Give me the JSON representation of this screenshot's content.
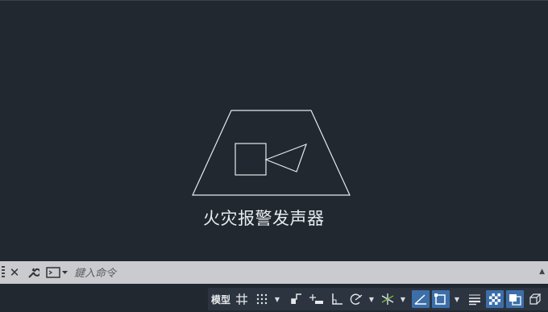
{
  "drawing": {
    "caption": "火灾报警发声器"
  },
  "command_line": {
    "placeholder": "鍵入命令"
  },
  "status_bar": {
    "model_tab": "模型",
    "accent_color": "#3c6fa9",
    "background": "#212830",
    "icons": [
      "grid-icon",
      "snap-grid-icon",
      "infer-constraints-icon",
      "dynamic-input-icon",
      "ortho-icon",
      "polar-tracking-icon",
      "isometric-icon",
      "object-snap-tracking-icon",
      "object-snap-icon",
      "lineweight-icon",
      "transparency-icon",
      "selection-cycling-icon",
      "3d-object-snap-icon"
    ]
  }
}
